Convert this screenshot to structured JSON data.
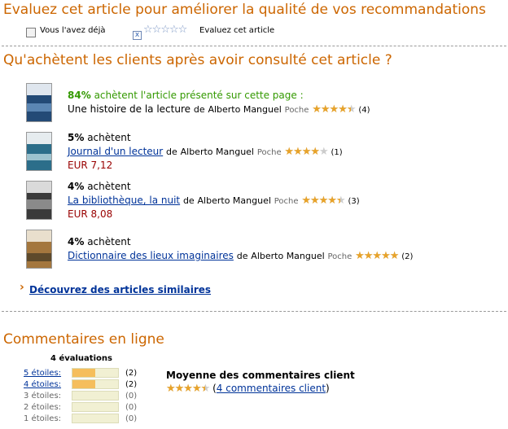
{
  "rate": {
    "title": "Evaluez cet article pour améliorer la qualité de vos recommandations",
    "owned_label": "Vous l'avez déjà",
    "evaluate_label": "Evaluez cet article",
    "x_mark": "x"
  },
  "also_bought": {
    "title": "Qu'achètent les clients après avoir consulté cet article ?",
    "items": [
      {
        "percent": "84%",
        "text": "achètent l'article présenté sur cette page :",
        "book_title": "Une histoire de la lecture",
        "by": "de",
        "author": "Alberto Manguel",
        "format": "Poche",
        "rating": 4.5,
        "count": "(4)",
        "price": ""
      },
      {
        "percent": "5%",
        "text": "achètent",
        "book_title": "Journal d'un lecteur",
        "by": "de",
        "author": "Alberto Manguel",
        "format": "Poche",
        "rating": 4,
        "count": "(1)",
        "price": "EUR 7,12"
      },
      {
        "percent": "4%",
        "text": "achètent",
        "book_title": "La bibliothèque, la nuit",
        "by": "de",
        "author": "Alberto Manguel",
        "format": "Poche",
        "rating": 4.5,
        "count": "(3)",
        "price": "EUR 8,08"
      },
      {
        "percent": "4%",
        "text": "achètent",
        "book_title": "Dictionnaire des lieux imaginaires",
        "by": "de",
        "author": "Alberto Manguel",
        "format": "Poche",
        "rating": 5,
        "count": "(2)",
        "price": ""
      }
    ],
    "similar_link": "Découvrez des articles similaires",
    "arrow": "›"
  },
  "reviews": {
    "title": "Commentaires en ligne",
    "total_label": "4 évaluations",
    "histogram": [
      {
        "label": "5 étoiles:",
        "count": "(2)",
        "fraction": 0.5,
        "link": true
      },
      {
        "label": "4 étoiles:",
        "count": "(2)",
        "fraction": 0.5,
        "link": true
      },
      {
        "label": "3 étoiles:",
        "count": "(0)",
        "fraction": 0,
        "link": false
      },
      {
        "label": "2 étoiles:",
        "count": "(0)",
        "fraction": 0,
        "link": false
      },
      {
        "label": "1 étoiles:",
        "count": "(0)",
        "fraction": 0,
        "link": false
      }
    ],
    "average_title": "Moyenne des commentaires client",
    "average_rating": 4.5,
    "open_paren": "(",
    "comments_link": "4 commentaires client",
    "close_paren": ")"
  },
  "colors": {
    "heading": "#cc6600",
    "link": "#003399",
    "percent_green": "#339900",
    "price": "#990000",
    "star_gold": "#e8a32a",
    "bar_fill": "#f5be5c",
    "bar_track": "#f1f0d3"
  }
}
